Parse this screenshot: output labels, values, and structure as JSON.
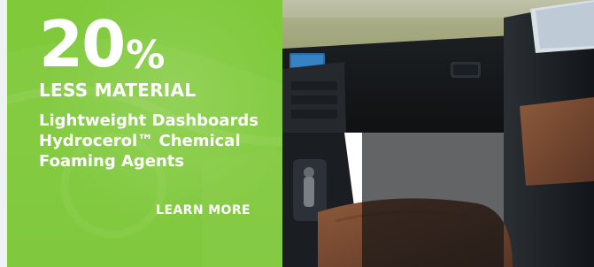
{
  "promo": {
    "number": "20",
    "percent": "%",
    "subhead": "LESS MATERIAL",
    "lines": [
      "Lightweight Dashboards",
      "Hydrocerol™ Chemical",
      "Foaming Agents"
    ],
    "cta_label": "LEARN MORE"
  },
  "colors": {
    "panel_green": "#7fc93a",
    "text": "#ffffff"
  },
  "photo": {
    "subject": "car-interior-photo"
  }
}
